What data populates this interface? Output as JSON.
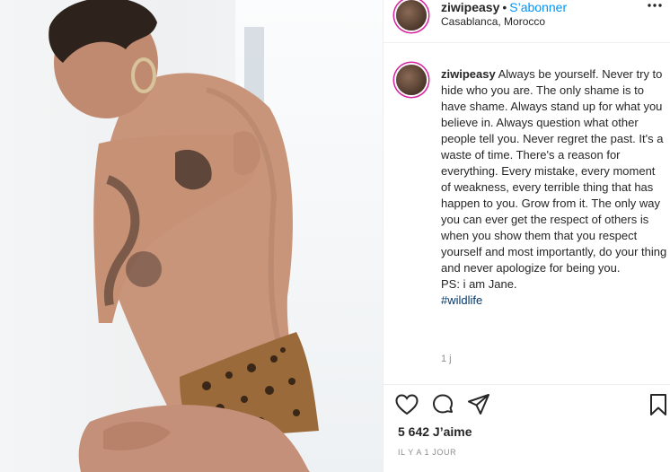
{
  "header": {
    "username": "ziwipeasy",
    "separator": "•",
    "follow_label": "S’abonner",
    "location": "Casablanca, Morocco",
    "more_icon": "more-horizontal-icon"
  },
  "caption": {
    "username": "ziwipeasy",
    "text": "Always be yourself. Never try to hide who you are. The only shame is to have shame. Always stand up for what you believe in. Always question what other people tell you. Never regret the past. It's a waste of time. There's a reason for everything. Every mistake, every moment of weakness, every terrible thing that has happen to you. Grow from it. The only way you can ever get the respect of others is when you show them that you respect yourself and most importantly, do your thing and never apologize for being you.",
    "ps": "PS: i am Jane.",
    "hashtag": "#wildlife",
    "time_ago": "1 j"
  },
  "actions": {
    "like_icon": "heart-icon",
    "comment_icon": "comment-icon",
    "share_icon": "share-icon",
    "save_icon": "bookmark-icon"
  },
  "likes": "5 642 J’aime",
  "post_date": "IL Y A 1 JOUR",
  "colors": {
    "follow": "#0095f6",
    "hashtag": "#00376b",
    "text": "#262626",
    "muted": "#8e8e8e",
    "story_ring": "#d6249f"
  }
}
